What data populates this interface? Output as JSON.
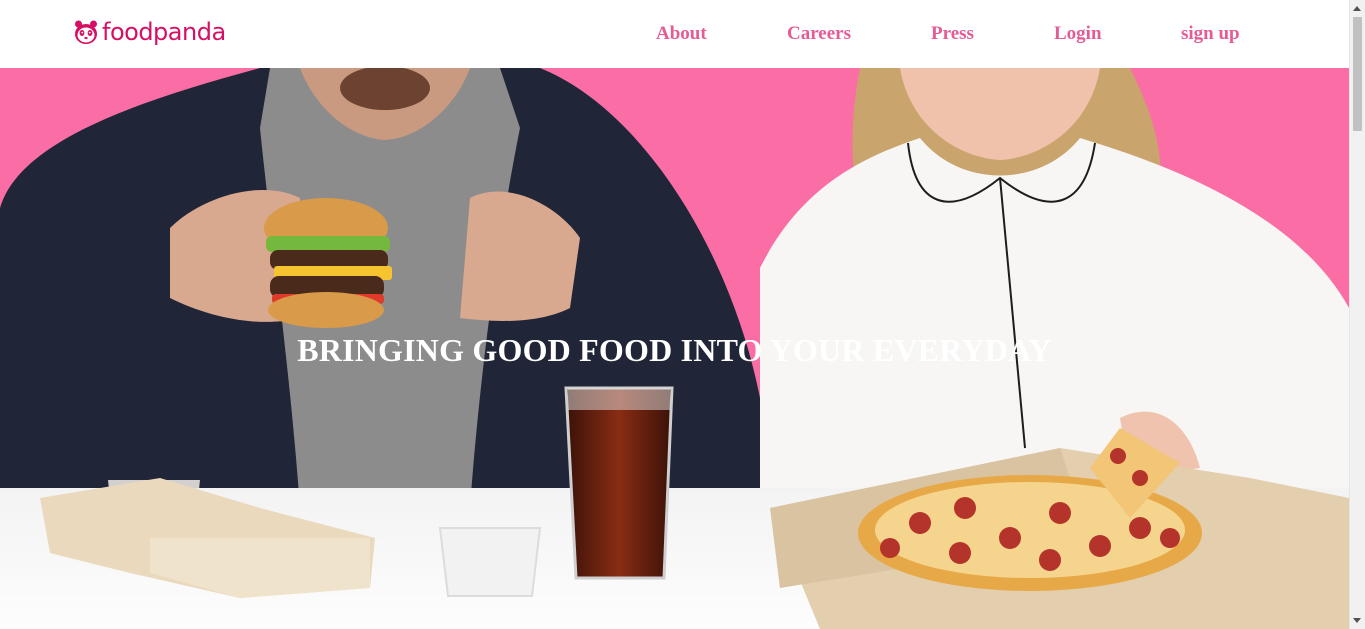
{
  "brand": {
    "name": "foodpanda",
    "icon": "panda-icon",
    "color": "#d70f64"
  },
  "nav": {
    "items": [
      {
        "label": "About"
      },
      {
        "label": "Careers"
      },
      {
        "label": "Press"
      },
      {
        "label": "Login"
      },
      {
        "label": "sign up"
      }
    ],
    "color": "#e55b95"
  },
  "hero": {
    "headline": "BRINGING GOOD FOOD INTO YOUR EVERYDAY",
    "background_color": "#fa6ea5"
  }
}
